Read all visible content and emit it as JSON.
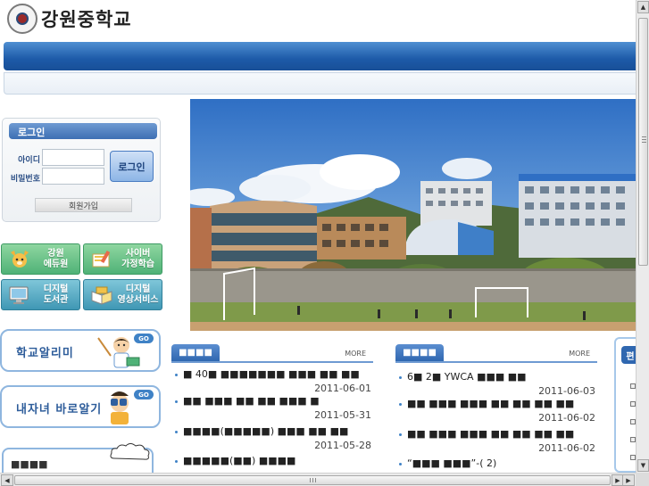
{
  "header": {
    "school_name": "강원중학교"
  },
  "login": {
    "title": "로그인",
    "id_label": "아이디",
    "password_label": "비밀번호",
    "id_value": "",
    "password_value": "",
    "login_button": "로그인",
    "signup_button": "회원가입"
  },
  "quick_links": [
    {
      "label": "강원\n에듀원",
      "icon": "fox-mascot-icon"
    },
    {
      "label": "사이버\n가정학습",
      "icon": "book-pencil-icon"
    },
    {
      "label": "디지털\n도서관",
      "icon": "computer-monitor-icon"
    },
    {
      "label": "디지털\n영상서비스",
      "icon": "open-book-icon"
    }
  ],
  "banners": {
    "notice_alert": {
      "label": "학교알리미",
      "go": "GO"
    },
    "career": {
      "label": "내자녀 바로알기",
      "go": "GO"
    }
  },
  "notice_corner": {
    "title": "■■■■"
  },
  "panel_left": {
    "tab": "■■■■",
    "more": "MORE",
    "posts": [
      {
        "title": "■ 40■ ■■■■■■■ ■■■ ■■ ■■",
        "date": "2011-06-01"
      },
      {
        "title": "■■ ■■■ ■■ ■■ ■■■ ■",
        "date": "2011-05-31"
      },
      {
        "title": "■■■■(■■■■■) ■■■ ■■ ■■",
        "date": "2011-05-28"
      },
      {
        "title": "■■■■■(■■) ■■■■",
        "date": ""
      }
    ]
  },
  "panel_right": {
    "tab": "■■■■",
    "more": "MORE",
    "posts": [
      {
        "title": "6■ 2■ YWCA ■■■ ■■",
        "date": "2011-06-03"
      },
      {
        "title": "■■ ■■■ ■■■ ■■ ■■ ■■ ■■",
        "date": "2011-06-02"
      },
      {
        "title": "■■ ■■■ ■■■ ■■ ■■ ■■ ■■",
        "date": "2011-06-02"
      },
      {
        "title": "“■■■ ■■■”-( 2)",
        "date": ""
      }
    ]
  },
  "right_panel": {
    "tab": "편"
  },
  "colors": {
    "nav_blue": "#1d5aa8",
    "quick_green": "#4fb277",
    "quick_teal": "#3f97b4",
    "banner_border": "#8fb6df"
  }
}
